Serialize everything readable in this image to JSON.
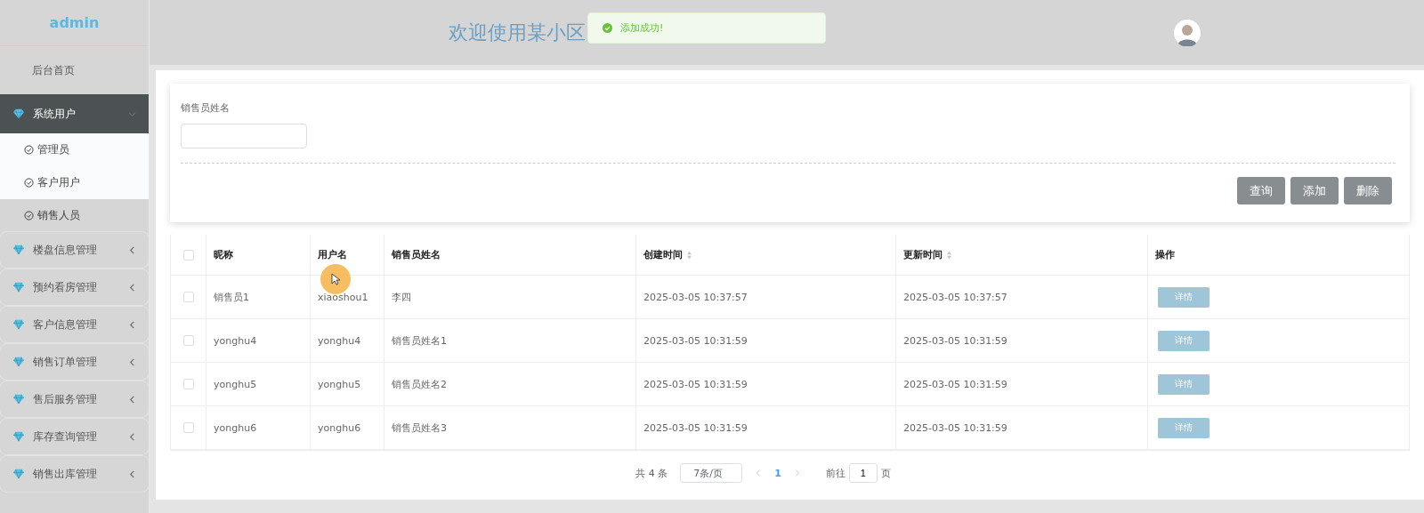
{
  "sidebar": {
    "logo": "admin",
    "items": [
      {
        "kind": "link",
        "label": "后台首页"
      },
      {
        "kind": "group",
        "label": "系统用户",
        "expanded": true,
        "children": [
          {
            "label": "管理员",
            "highlighted": true
          },
          {
            "label": "客户用户",
            "highlighted": true
          },
          {
            "label": "销售人员",
            "highlighted": false
          }
        ]
      },
      {
        "kind": "group",
        "label": "楼盘信息管理",
        "expanded": false
      },
      {
        "kind": "group",
        "label": "预约看房管理",
        "expanded": false
      },
      {
        "kind": "group",
        "label": "客户信息管理",
        "expanded": false
      },
      {
        "kind": "group",
        "label": "销售订单管理",
        "expanded": false
      },
      {
        "kind": "group",
        "label": "售后服务管理",
        "expanded": false
      },
      {
        "kind": "group",
        "label": "库存查询管理",
        "expanded": false
      },
      {
        "kind": "group",
        "label": "销售出库管理",
        "expanded": false
      }
    ]
  },
  "header": {
    "title": "欢迎使用某小区"
  },
  "toast": {
    "kind": "success",
    "message": "添加成功!"
  },
  "search": {
    "fields": [
      {
        "label": "销售员姓名"
      }
    ],
    "buttons": [
      "查询",
      "添加",
      "删除"
    ]
  },
  "table": {
    "all_checked": false,
    "columns": [
      {
        "label": "昵称",
        "kind": "plain"
      },
      {
        "label": "用户名",
        "kind": "plain"
      },
      {
        "label": "销售员姓名",
        "kind": "plain"
      },
      {
        "label": "创建时间",
        "kind": "sortable"
      },
      {
        "label": "更新时间",
        "kind": "sortable"
      },
      {
        "label": "操作",
        "kind": "plain"
      }
    ],
    "rows": [
      {
        "checked": false,
        "cells": [
          "销售员1",
          "xiaoshou1",
          "李四",
          "2025-03-05 10:37:57",
          "2025-03-05 10:37:57"
        ],
        "action": "详情"
      },
      {
        "checked": false,
        "cells": [
          "yonghu4",
          "yonghu4",
          "销售员姓名1",
          "2025-03-05 10:31:59",
          "2025-03-05 10:31:59"
        ],
        "action": "详情"
      },
      {
        "checked": false,
        "cells": [
          "yonghu5",
          "yonghu5",
          "销售员姓名2",
          "2025-03-05 10:31:59",
          "2025-03-05 10:31:59"
        ],
        "action": "详情"
      },
      {
        "checked": false,
        "cells": [
          "yonghu6",
          "yonghu6",
          "销售员姓名3",
          "2025-03-05 10:31:59",
          "2025-03-05 10:31:59"
        ],
        "action": "详情"
      }
    ]
  },
  "pagination": {
    "total": "共 4 条",
    "page_size": "7条/页",
    "pages": [
      {
        "label": "1",
        "selected": true
      }
    ],
    "goto_label": "前往",
    "goto_value": "1",
    "goto_suffix": "页"
  }
}
